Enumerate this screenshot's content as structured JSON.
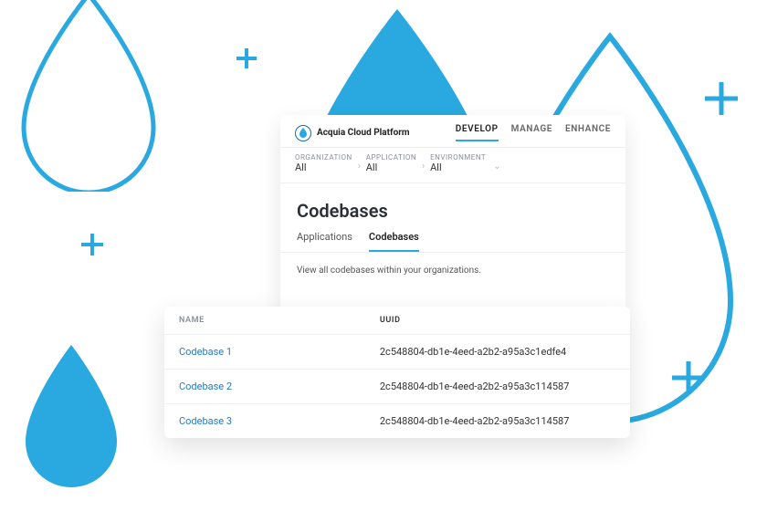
{
  "brand": "Acquia Cloud Platform",
  "topnav": [
    {
      "label": "DEVELOP",
      "active": true
    },
    {
      "label": "MANAGE",
      "active": false
    },
    {
      "label": "ENHANCE",
      "active": false
    }
  ],
  "breadcrumb": [
    {
      "label": "ORGANIZATION",
      "value": "All"
    },
    {
      "label": "APPLICATION",
      "value": "All"
    },
    {
      "label": "ENVIRONMENT",
      "value": "All"
    }
  ],
  "page_title": "Codebases",
  "subtabs": [
    {
      "label": "Applications",
      "active": false
    },
    {
      "label": "Codebases",
      "active": true
    }
  ],
  "description": "View all codebases within your organizations.",
  "table": {
    "columns": {
      "name": "NAME",
      "uuid": "UUID"
    },
    "rows": [
      {
        "name": "Codebase 1",
        "uuid": "2c548804-db1e-4eed-a2b2-a95a3c1edfe4"
      },
      {
        "name": "Codebase 2",
        "uuid": "2c548804-db1e-4eed-a2b2-a95a3c114587"
      },
      {
        "name": "Codebase 3",
        "uuid": "2c548804-db1e-4eed-a2b2-a95a3c114587"
      }
    ]
  }
}
